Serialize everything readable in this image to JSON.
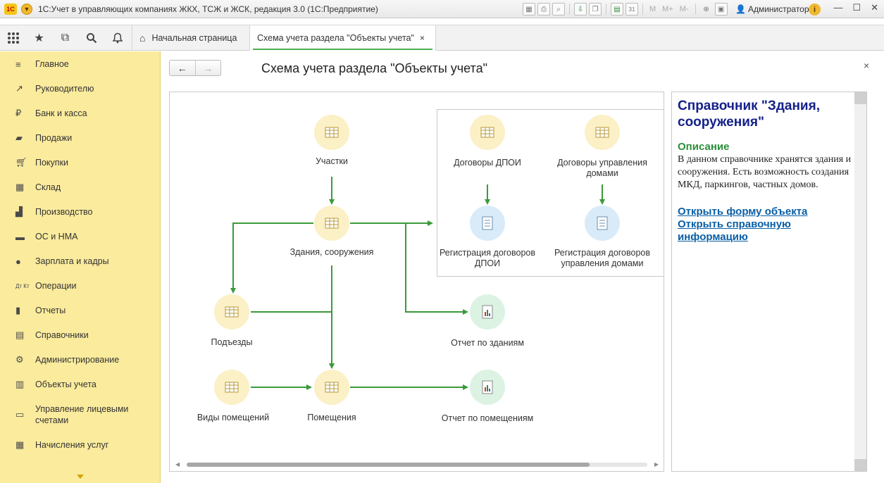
{
  "window": {
    "logo": "1С",
    "title": "1С:Учет в управляющих компаниях ЖКХ, ТСЖ и ЖСК, редакция 3.0  (1С:Предприятие)",
    "calendar_day": "31",
    "m_buttons": [
      "M",
      "M+",
      "M-"
    ],
    "user": "Администратор",
    "info": "i"
  },
  "tabs": {
    "home": "Начальная страница",
    "active": "Схема учета раздела \"Объекты учета\"",
    "close": "×"
  },
  "sidebar": {
    "items": [
      {
        "label": "Главное",
        "icon": "menu-icon"
      },
      {
        "label": "Руководителю",
        "icon": "trend-icon"
      },
      {
        "label": "Банк и касса",
        "icon": "ruble-icon"
      },
      {
        "label": "Продажи",
        "icon": "bag-icon"
      },
      {
        "label": "Покупки",
        "icon": "cart-icon"
      },
      {
        "label": "Склад",
        "icon": "warehouse-icon"
      },
      {
        "label": "Производство",
        "icon": "factory-icon"
      },
      {
        "label": "ОС и НМА",
        "icon": "truck-icon"
      },
      {
        "label": "Зарплата и кадры",
        "icon": "person-icon"
      },
      {
        "label": "Операции",
        "icon": "dt-kt-icon"
      },
      {
        "label": "Отчеты",
        "icon": "bar-chart-icon"
      },
      {
        "label": "Справочники",
        "icon": "book-icon"
      },
      {
        "label": "Администрирование",
        "icon": "gear-icon"
      },
      {
        "label": "Объекты учета",
        "icon": "building-icon"
      },
      {
        "label": "Управление лицевыми счетами",
        "icon": "accounts-icon"
      },
      {
        "label": "Начисления услуг",
        "icon": "calculator-icon"
      }
    ]
  },
  "page": {
    "title": "Схема учета раздела \"Объекты учета\"",
    "back": "←",
    "forward": "→",
    "close": "×"
  },
  "diagram": {
    "nodes": {
      "uchastki": "Участки",
      "zdaniya": "Здания, сооружения",
      "podezdy": "Подъезды",
      "vidy": "Виды помещений",
      "pomescheniya": "Помещения",
      "dogovory_dpoi": "Договоры ДПОИ",
      "dogovory_upr": "Договоры управления домами",
      "reg_dpoi": "Регистрация договоров ДПОИ",
      "reg_upr": "Регистрация договоров управления домами",
      "otchet_zdaniya": "Отчет по зданиям",
      "otchet_pomescheniya": "Отчет по помещениям"
    },
    "colors": {
      "arrow": "#3a9a3a",
      "catalog_bg": "#fbf0c6",
      "document_bg": "#d9ebf9",
      "report_bg": "#dcf3e3"
    }
  },
  "info_panel": {
    "title": "Справочник \"Здания, сооружения\"",
    "heading": "Описание",
    "text": "В данном справочнике хранятся здания и сооружения. Есть возможность создания МКД, паркингов, частных домов.",
    "link_form": "Открыть форму объекта",
    "link_help": "Открыть справочную информацию"
  }
}
